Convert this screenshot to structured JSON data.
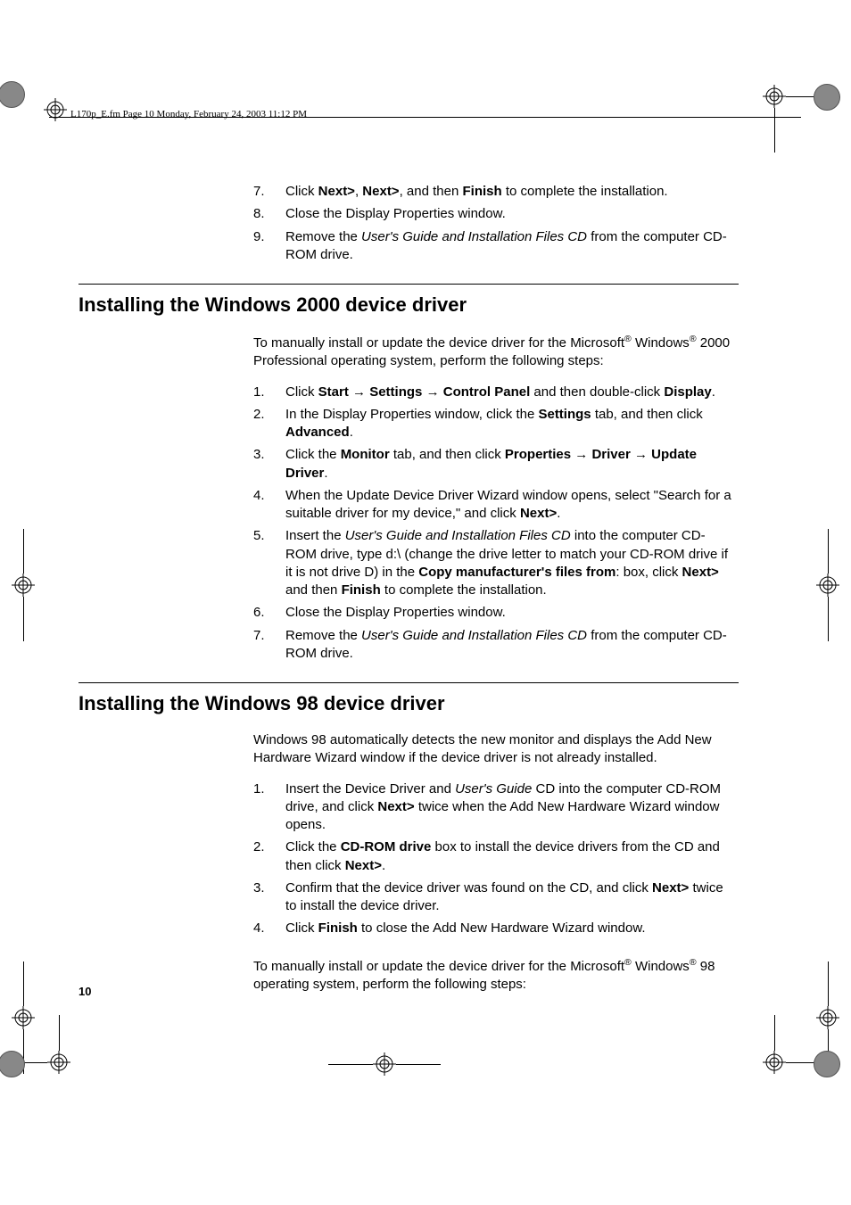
{
  "header": "L170p_E.fm  Page 10  Monday, February 24, 2003  11:12 PM",
  "sectionA": {
    "items": [
      {
        "n": "7.",
        "html": "Click <span class='b'>Next></span>, <span class='b'>Next></span>, and then <span class='b'>Finish</span> to complete the installation."
      },
      {
        "n": "8.",
        "html": "Close the Display Properties window."
      },
      {
        "n": "9.",
        "html": "Remove the <span class='i'>User's Guide and Installation Files CD</span> from the computer CD-ROM drive."
      }
    ]
  },
  "sectionB": {
    "heading": "Installing the Windows 2000 device driver",
    "intro": "To manually install or update the device driver for the Microsoft<sup>®</sup> Windows<sup>®</sup> 2000 Professional operating system, perform the following steps:",
    "items": [
      {
        "n": "1.",
        "html": "Click <span class='b'>Start</span> <span class='arrow'>→</span> <span class='b'>Settings</span> <span class='arrow'>→</span> <span class='b'>Control Panel</span> and then double-click <span class='b'>Display</span>."
      },
      {
        "n": "2.",
        "html": "In the Display Properties window, click the <span class='b'>Settings</span> tab, and then click <span class='b'>Advanced</span>."
      },
      {
        "n": "3.",
        "html": "Click the <span class='b'>Monitor</span> tab, and then click <span class='b'>Properties</span> <span class='arrow'>→</span> <span class='b'>Driver</span> <span class='arrow'>→</span> <span class='b'>Update Driver</span>."
      },
      {
        "n": "4.",
        "html": "When the Update Device Driver Wizard window opens, select \"Search for a suitable driver for my device,\" and click <span class='b'>Next></span>."
      },
      {
        "n": "5.",
        "html": "Insert the <span class='i'>User's Guide and Installation Files CD</span> into the computer CD-ROM drive, type d:\\ (change the drive letter to match your CD-ROM drive if it is not drive D) in the <span class='b'>Copy manufacturer's files from</span>: box, click <span class='b'>Next></span> and then <span class='b'>Finish</span> to complete the installation."
      },
      {
        "n": "6.",
        "html": "Close the Display Properties window."
      },
      {
        "n": "7.",
        "html": "Remove the <span class='i'>User's Guide and Installation Files CD</span> from the computer CD-ROM drive."
      }
    ]
  },
  "sectionC": {
    "heading": "Installing the Windows 98 device driver",
    "intro": "Windows 98 automatically detects the new monitor and displays the Add New Hardware Wizard window if the device driver is not already installed.",
    "items": [
      {
        "n": "1.",
        "html": "Insert the Device Driver and <span class='i'>User's Guide</span> CD into the computer CD-ROM drive, and click <span class='b'>Next></span> twice when the Add New Hardware Wizard window opens."
      },
      {
        "n": "2.",
        "html": "Click the <span class='b'>CD-ROM drive</span> box to install the device drivers from the CD and then click <span class='b'>Next></span>."
      },
      {
        "n": "3.",
        "html": "Confirm that the device driver was found on the CD, and click <span class='b'>Next></span> twice to install the device driver."
      },
      {
        "n": "4.",
        "html": "Click <span class='b'>Finish</span> to close the Add New Hardware Wizard window."
      }
    ],
    "outro": "To manually install or update the device driver for the Microsoft<sup>®</sup> Windows<sup>®</sup> 98 operating system, perform the following steps:"
  },
  "pageNumber": "10"
}
